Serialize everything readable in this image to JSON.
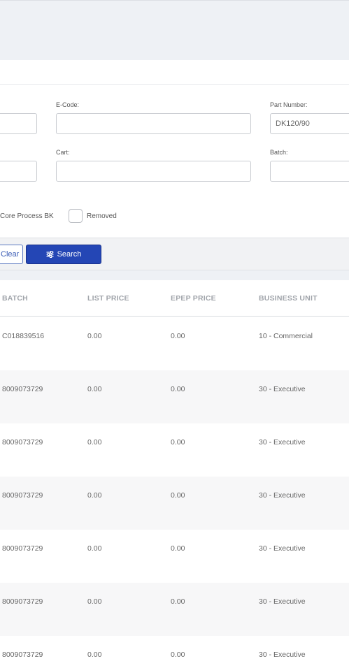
{
  "form": {
    "ecode_label": "E-Code:",
    "ecode_value": "",
    "part_number_label": "Part Number:",
    "part_number_value": "DK120/90",
    "cart_label": "Cart:",
    "cart_value": "",
    "batch_label": "Batch:",
    "batch_value": "",
    "core_process_label": "Core Process BK",
    "removed_label": "Removed"
  },
  "actions": {
    "clear_label": "Clear",
    "search_label": "Search"
  },
  "table": {
    "columns": [
      "BATCH",
      "LIST PRICE",
      "EPEP PRICE",
      "BUSINESS UNIT"
    ],
    "rows": [
      {
        "batch": "C018839516",
        "list_price": "0.00",
        "epep_price": "0.00",
        "business_unit": "10 - Commercial"
      },
      {
        "batch": "8009073729",
        "list_price": "0.00",
        "epep_price": "0.00",
        "business_unit": "30 - Executive"
      },
      {
        "batch": "8009073729",
        "list_price": "0.00",
        "epep_price": "0.00",
        "business_unit": "30 - Executive"
      },
      {
        "batch": "8009073729",
        "list_price": "0.00",
        "epep_price": "0.00",
        "business_unit": "30 - Executive"
      },
      {
        "batch": "8009073729",
        "list_price": "0.00",
        "epep_price": "0.00",
        "business_unit": "30 - Executive"
      },
      {
        "batch": "8009073729",
        "list_price": "0.00",
        "epep_price": "0.00",
        "business_unit": "30 - Executive"
      },
      {
        "batch": "8009073729",
        "list_price": "0.00",
        "epep_price": "0.00",
        "business_unit": "30 - Executive"
      }
    ]
  }
}
